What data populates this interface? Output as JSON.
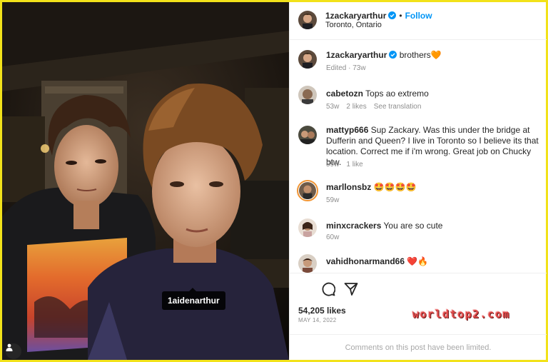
{
  "header": {
    "username": "1zackaryarthur",
    "follow_label": "Follow",
    "separator": "•",
    "location": "Toronto, Ontario"
  },
  "photo": {
    "tag_label": "1aidenarthur"
  },
  "caption": {
    "username": "1zackaryarthur",
    "text": "brothers🧡",
    "meta": "Edited · 73w"
  },
  "comments": [
    {
      "username": "cabetozn",
      "text": "Tops ao extremo",
      "age": "53w",
      "likes": "2 likes",
      "extra": "See translation"
    },
    {
      "username": "mattyp666",
      "text": "Sup Zackary. Was this under the bridge at Dufferin and Queen? I live in Toronto so I believe its that location. Correct me if i'm wrong. Great job on Chucky btw.",
      "age": "59w",
      "likes": "1 like",
      "extra": ""
    },
    {
      "username": "marllonsbz",
      "text": "🤩🤩🤩🤩",
      "age": "59w",
      "likes": "",
      "extra": ""
    },
    {
      "username": "minxcrackers",
      "text": "You are so cute",
      "age": "60w",
      "likes": "",
      "extra": ""
    },
    {
      "username": "vahidhonarmand66",
      "text": "❤️🔥",
      "age": "",
      "likes": "",
      "extra": ""
    }
  ],
  "actions": {
    "likes": "54,205 likes",
    "date": "MAY 14, 2022",
    "watermark": "worldtop2.com"
  },
  "footer": {
    "limited_text": "Comments on this post have been limited."
  },
  "icons": {
    "comment": "comment-icon",
    "share": "share-icon",
    "verified": "verified-badge-icon",
    "user_tag": "user-tag-icon"
  },
  "colors": {
    "follow": "#0095f6",
    "verified": "#0095f6",
    "frame": "#f2e21a",
    "watermark": "#e04a4a"
  }
}
